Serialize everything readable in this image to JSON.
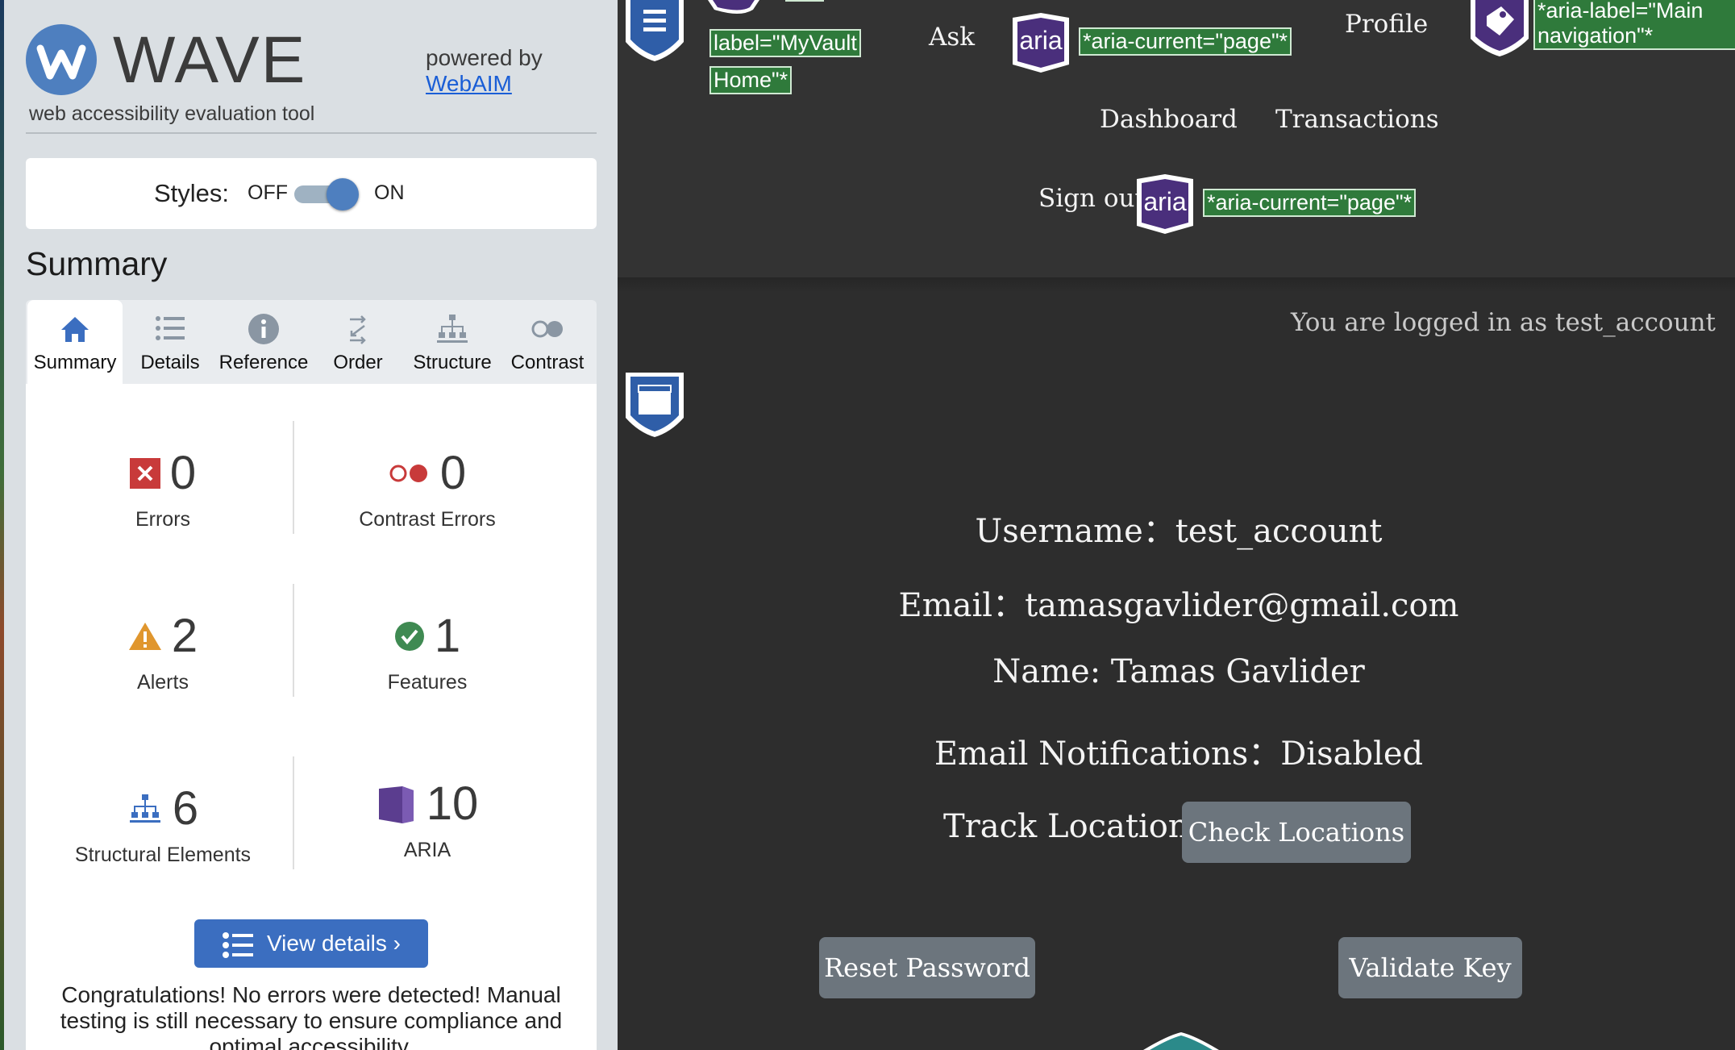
{
  "wave": {
    "logo_text": "WAVE",
    "logo_sub": "web accessibility evaluation tool",
    "powered_by": "powered by",
    "powered_link": "WebAIM",
    "styles": {
      "label": "Styles:",
      "off": "OFF",
      "on": "ON",
      "state": "on"
    },
    "summary_title": "Summary",
    "tabs": [
      {
        "label": "Summary",
        "icon": "home-icon",
        "active": true
      },
      {
        "label": "Details",
        "icon": "list-icon",
        "active": false
      },
      {
        "label": "Reference",
        "icon": "info-icon",
        "active": false
      },
      {
        "label": "Order",
        "icon": "order-icon",
        "active": false
      },
      {
        "label": "Structure",
        "icon": "structure-icon",
        "active": false
      },
      {
        "label": "Contrast",
        "icon": "contrast-icon",
        "active": false
      }
    ],
    "stats": {
      "errors": {
        "count": "0",
        "label": "Errors",
        "icon": "error-icon",
        "color": "#c83a3a"
      },
      "contrast_errors": {
        "count": "0",
        "label": "Contrast Errors",
        "icon": "contrast-error-icon",
        "color": "#c83a3a"
      },
      "alerts": {
        "count": "2",
        "label": "Alerts",
        "icon": "alert-icon",
        "color": "#e0962e"
      },
      "features": {
        "count": "1",
        "label": "Features",
        "icon": "feature-icon",
        "color": "#3f8a52"
      },
      "structural": {
        "count": "6",
        "label": "Structural Elements",
        "icon": "structure-icon",
        "color": "#3b6ec0"
      },
      "aria": {
        "count": "10",
        "label": "ARIA",
        "icon": "aria-icon",
        "color": "#5b3d8f"
      }
    },
    "view_details": "View details ›",
    "congrats": "Congratulations! No errors were detected! Manual testing is still necessary to ensure compliance and optimal accessibility."
  },
  "site": {
    "nav": {
      "tag_home": "label=\"MyVault",
      "tag_home2": "Home\"*",
      "ask": "Ask",
      "profile": "Profile",
      "dashboard": "Dashboard",
      "transactions": "Transactions",
      "sign_out": "Sign out",
      "aria_badge": "aria",
      "tag_current1": "*aria-current=\"page\"*",
      "tag_current2": "*aria-current=\"page\"*",
      "tag_main_nav1": "*aria-label=\"Main",
      "tag_main_nav2": "navigation\"*"
    },
    "logged_in": "You are logged in as test_account",
    "profile": {
      "username": "Username：test_account",
      "email": "Email：tamasgavlider@gmail.com",
      "name": "Name: Tamas Gavlider",
      "notifications": "Email Notifications：Disabled",
      "track_location_label": "Track Location:",
      "check_locations": "Check Locations"
    },
    "buttons": {
      "reset_password": "Reset Password",
      "validate_key": "Validate Key"
    }
  }
}
